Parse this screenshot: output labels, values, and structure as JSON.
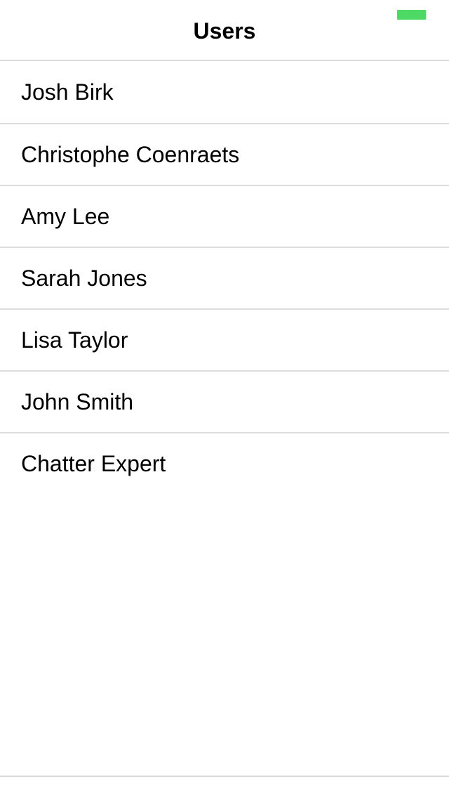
{
  "status_bar": {
    "battery_color": "#4cd964"
  },
  "nav_bar": {
    "title": "Users"
  },
  "users": [
    {
      "name": "Josh Birk"
    },
    {
      "name": "Christophe Coenraets"
    },
    {
      "name": "Amy Lee"
    },
    {
      "name": "Sarah Jones"
    },
    {
      "name": "Lisa Taylor"
    },
    {
      "name": "John Smith"
    },
    {
      "name": "Chatter Expert"
    }
  ]
}
